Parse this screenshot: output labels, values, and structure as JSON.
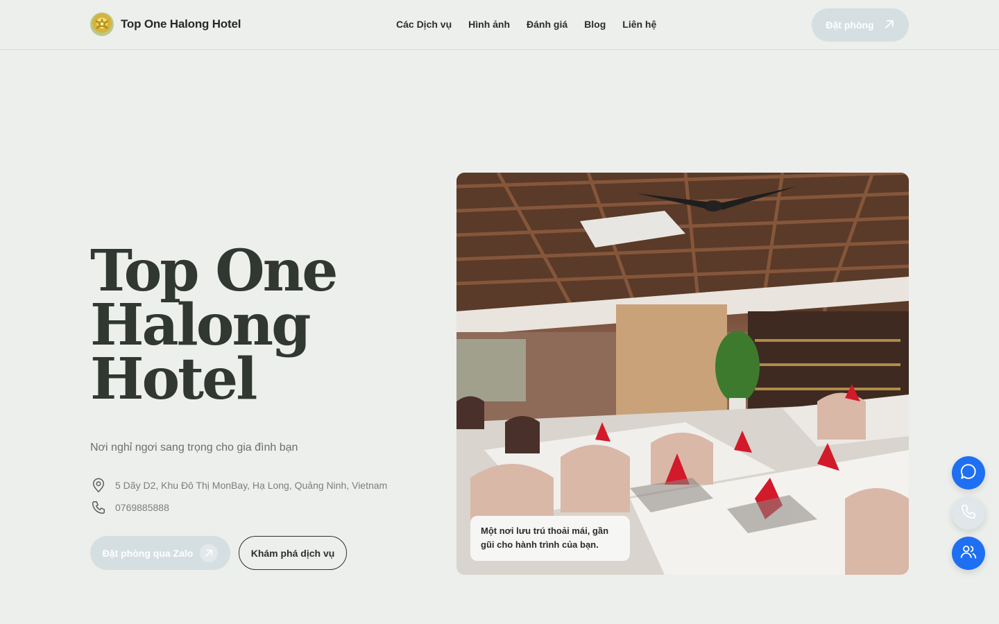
{
  "header": {
    "brand_name": "Top One Halong Hotel",
    "nav": [
      "Các Dịch vụ",
      "Hình ảnh",
      "Đánh giá",
      "Blog",
      "Liên hệ"
    ],
    "book_label": "Đặt phòng"
  },
  "hero": {
    "title_lines": [
      "Top One",
      "Halong",
      "Hotel"
    ],
    "subtitle": "Nơi nghỉ ngơi sang trọng cho gia đình bạn",
    "address": "5 Dãy D2, Khu Đô Thị MonBay, Hạ Long, Quảng Ninh, Vietnam",
    "phone": "0769885888",
    "cta_zalo": "Đặt phòng qua Zalo",
    "cta_explore": "Khám phá dịch vụ",
    "image_caption": "Một nơi lưu trú thoải mái, gần gũi cho hành trình của bạn."
  },
  "floating": {
    "icons": [
      "chat-icon",
      "phone-icon",
      "users-icon"
    ]
  },
  "colors": {
    "background": "#ecefec",
    "accent_blue": "#1f6ff2",
    "muted_button": "#d5dfe1",
    "title_text": "#313731"
  }
}
